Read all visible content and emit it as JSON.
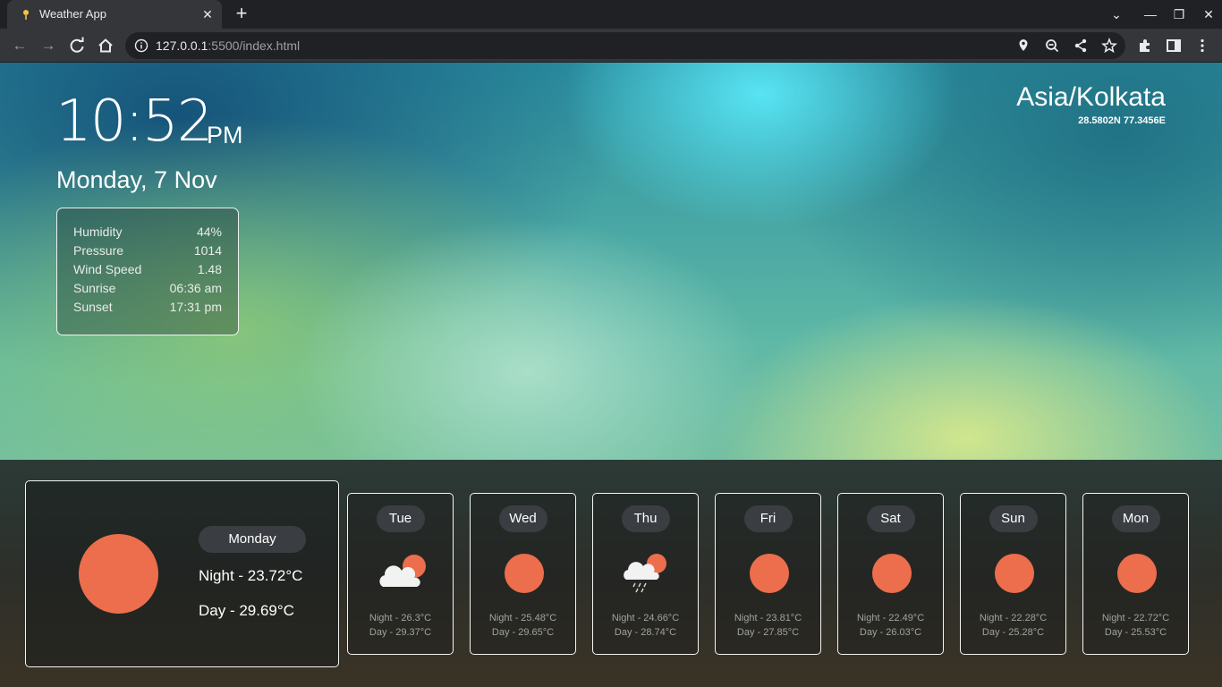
{
  "browser": {
    "tab_title": "Weather App",
    "url_host": "127.0.0.1",
    "url_path": ":5500/index.html"
  },
  "weather": {
    "time": "10:52",
    "ampm": "PM",
    "date": "Monday, 7 Nov",
    "timezone": "Asia/Kolkata",
    "coords": "28.5802N 77.3456E",
    "details": [
      {
        "label": "Humidity",
        "value": "44%"
      },
      {
        "label": "Pressure",
        "value": "1014"
      },
      {
        "label": "Wind Speed",
        "value": "1.48"
      },
      {
        "label": "Sunrise",
        "value": "06:36 am"
      },
      {
        "label": "Sunset",
        "value": "17:31 pm"
      }
    ],
    "today": {
      "day": "Monday",
      "night": "Night - 23.72°C",
      "day_temp": "Day - 29.69°C",
      "icon": "sun-icon"
    },
    "forecast": [
      {
        "day": "Tue",
        "icon": "cloud-sun-icon",
        "night": "Night - 26.3°C",
        "day_temp": "Day - 29.37°C"
      },
      {
        "day": "Wed",
        "icon": "sun-icon",
        "night": "Night - 25.48°C",
        "day_temp": "Day - 29.65°C"
      },
      {
        "day": "Thu",
        "icon": "rain-sun-icon",
        "night": "Night - 24.66°C",
        "day_temp": "Day - 28.74°C"
      },
      {
        "day": "Fri",
        "icon": "sun-icon",
        "night": "Night - 23.81°C",
        "day_temp": "Day - 27.85°C"
      },
      {
        "day": "Sat",
        "icon": "sun-icon",
        "night": "Night - 22.49°C",
        "day_temp": "Day - 26.03°C"
      },
      {
        "day": "Sun",
        "icon": "sun-icon",
        "night": "Night - 22.28°C",
        "day_temp": "Day - 25.28°C"
      },
      {
        "day": "Mon",
        "icon": "sun-icon",
        "night": "Night - 22.72°C",
        "day_temp": "Day - 25.53°C"
      }
    ]
  },
  "colors": {
    "sun": "#ec6e4c",
    "pill": "#3a3d42"
  }
}
